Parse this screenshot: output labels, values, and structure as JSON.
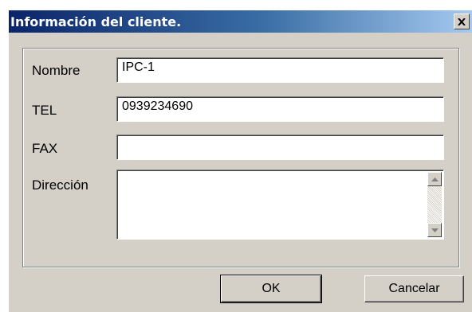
{
  "dialog": {
    "title": "Información del cliente.",
    "close_icon": "close-icon"
  },
  "form": {
    "nombre_label": "Nombre",
    "nombre_value": "IPC-1",
    "tel_label": "TEL",
    "tel_value": "0939234690",
    "fax_label": "FAX",
    "fax_value": "",
    "direccion_label": "Dirección",
    "direccion_value": ""
  },
  "buttons": {
    "ok_label": "OK",
    "cancel_label": "Cancelar"
  }
}
